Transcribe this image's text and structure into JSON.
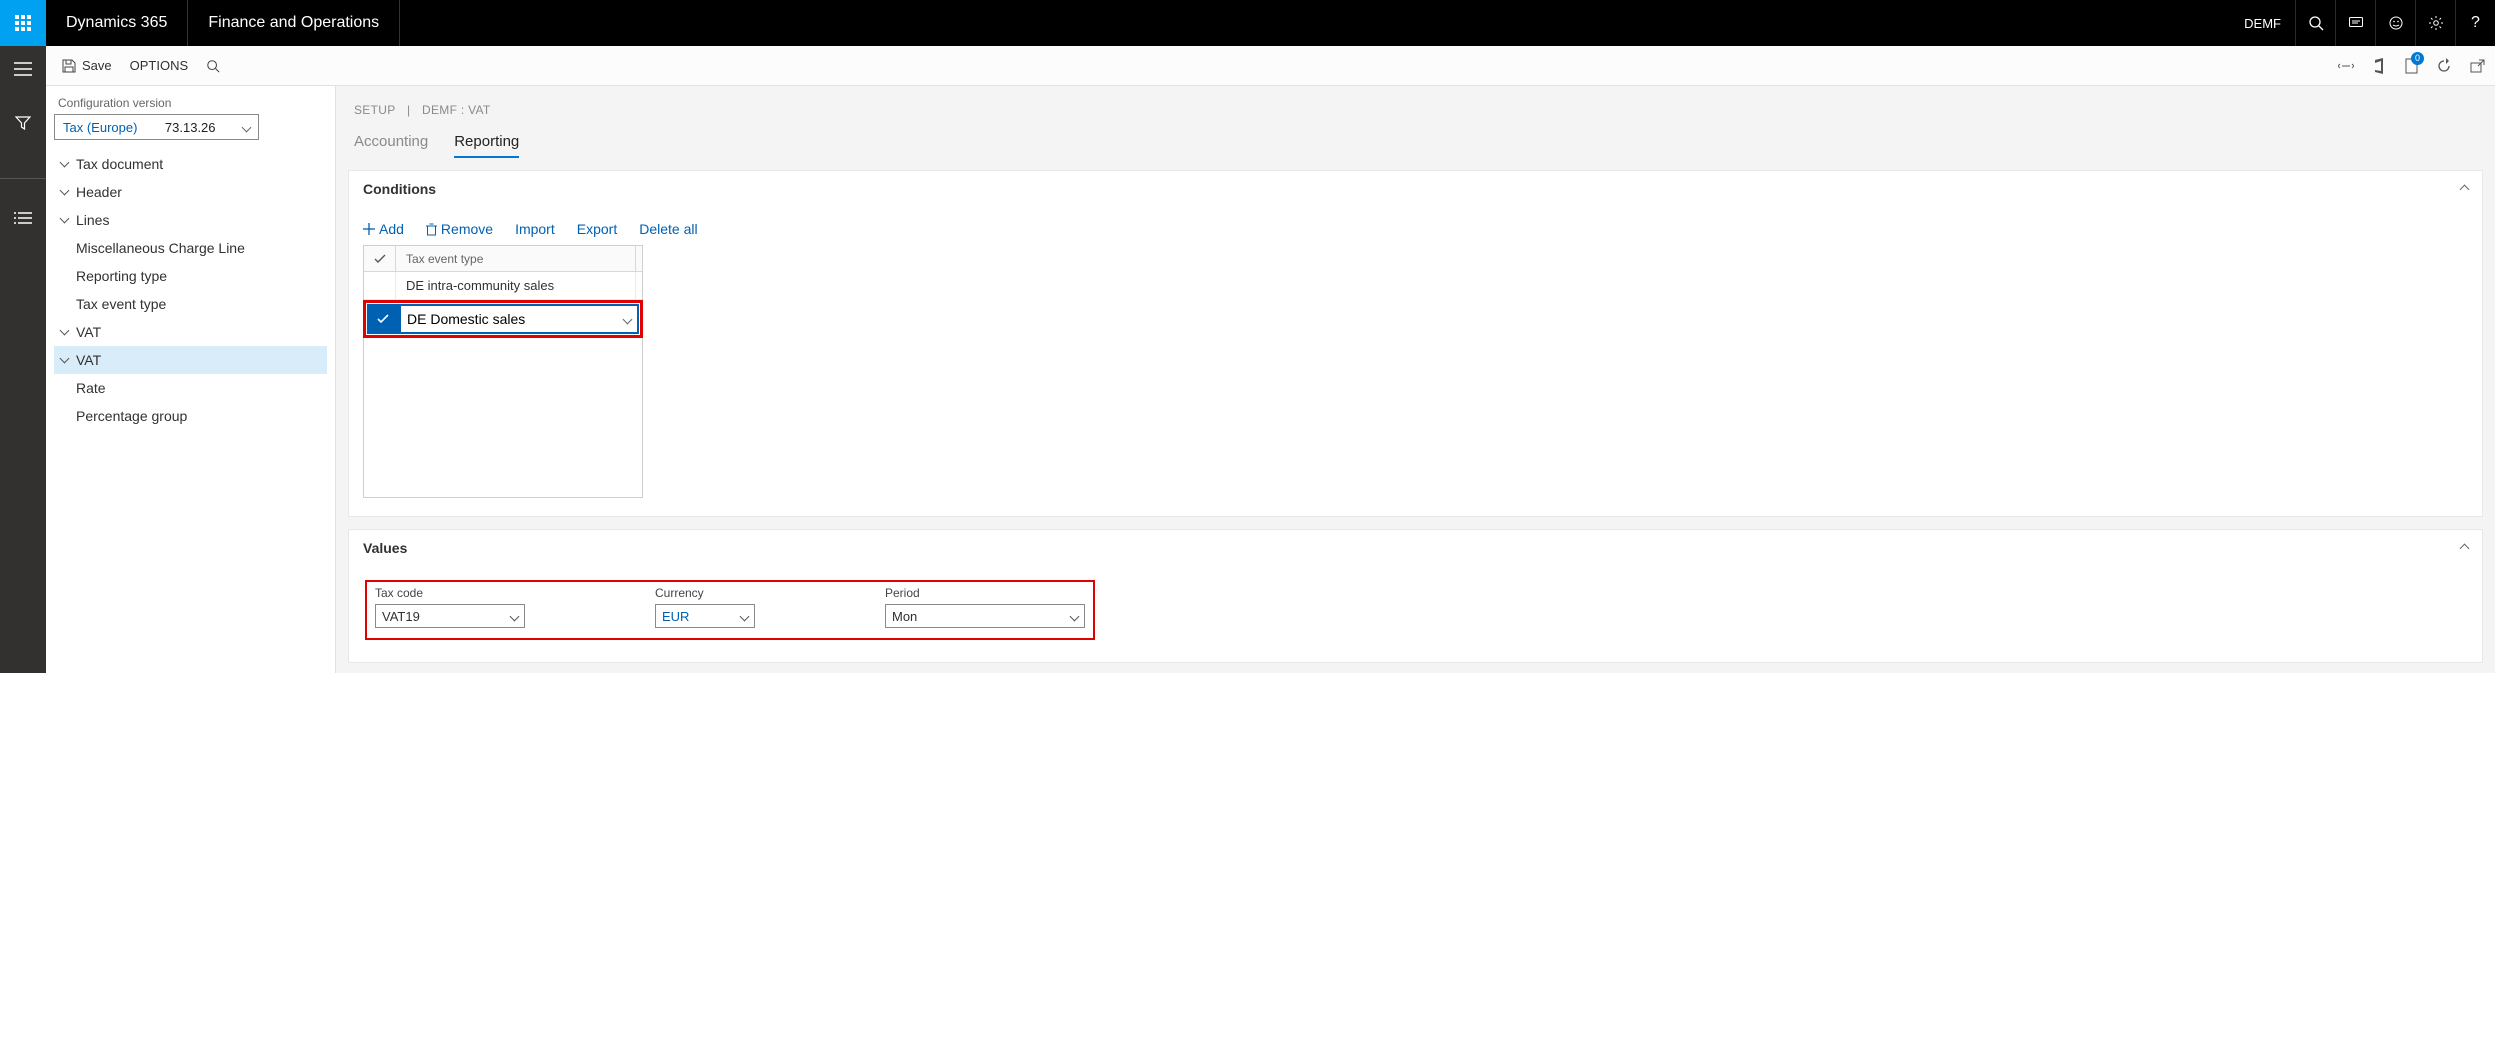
{
  "topbar": {
    "brand_primary": "Dynamics 365",
    "brand_secondary": "Finance and Operations",
    "company": "DEMF"
  },
  "actionbar": {
    "save_label": "Save",
    "options_label": "OPTIONS",
    "notif_count": "0"
  },
  "sidebar": {
    "config_version_label": "Configuration version",
    "config_name": "Tax (Europe)",
    "config_version": "73.13.26",
    "tree": {
      "n0": "Tax document",
      "n1": "Header",
      "n2": "Lines",
      "n3": "Miscellaneous Charge Line",
      "n4": "Reporting type",
      "n5": "Tax event type",
      "n6": "VAT",
      "n7": "VAT",
      "n8": "Rate",
      "n9": "Percentage group"
    }
  },
  "main": {
    "breadcrumb": {
      "a": "SETUP",
      "b": "DEMF : VAT"
    },
    "tabs": {
      "accounting": "Accounting",
      "reporting": "Reporting"
    },
    "conditions": {
      "title": "Conditions",
      "toolbar": {
        "add": "Add",
        "remove": "Remove",
        "import": "Import",
        "export": "Export",
        "delete_all": "Delete all"
      },
      "col_header": "Tax event type",
      "rows": {
        "r0": "DE intra-community sales",
        "r1": "DE Domestic sales"
      }
    },
    "values": {
      "title": "Values",
      "fields": {
        "tax_code": {
          "label": "Tax code",
          "value": "VAT19"
        },
        "currency": {
          "label": "Currency",
          "value": "EUR"
        },
        "period": {
          "label": "Period",
          "value": "Mon"
        }
      }
    }
  }
}
